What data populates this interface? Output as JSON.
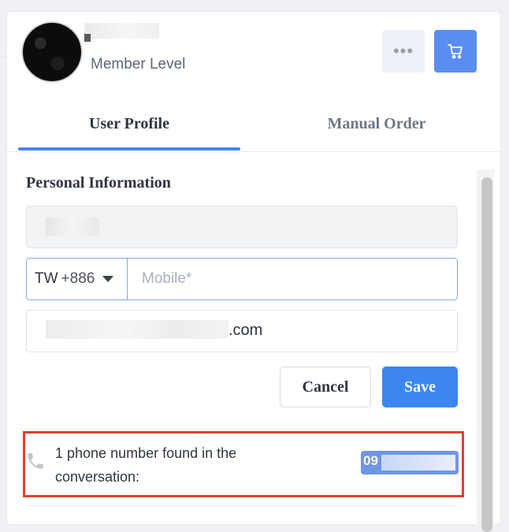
{
  "header": {
    "member_level": "Member Level",
    "more_icon": "ellipsis-icon",
    "cart_icon": "cart-icon"
  },
  "tabs": [
    {
      "label": "User Profile",
      "active": true
    },
    {
      "label": "Manual Order",
      "active": false
    }
  ],
  "personal_info": {
    "title": "Personal Information",
    "country_code": "TW",
    "dial_code": "+886",
    "mobile_placeholder": "Mobile*",
    "email_domain_suffix": ".com",
    "cancel_label": "Cancel",
    "save_label": "Save"
  },
  "phone_found": {
    "text": "1 phone number found in the conversation:",
    "number_prefix": "09",
    "icon": "phone-icon"
  },
  "colors": {
    "accent": "#4a84f0",
    "save_button": "#3d86f2",
    "cart_button": "#5b8df0",
    "highlight_border": "#e0412f"
  }
}
